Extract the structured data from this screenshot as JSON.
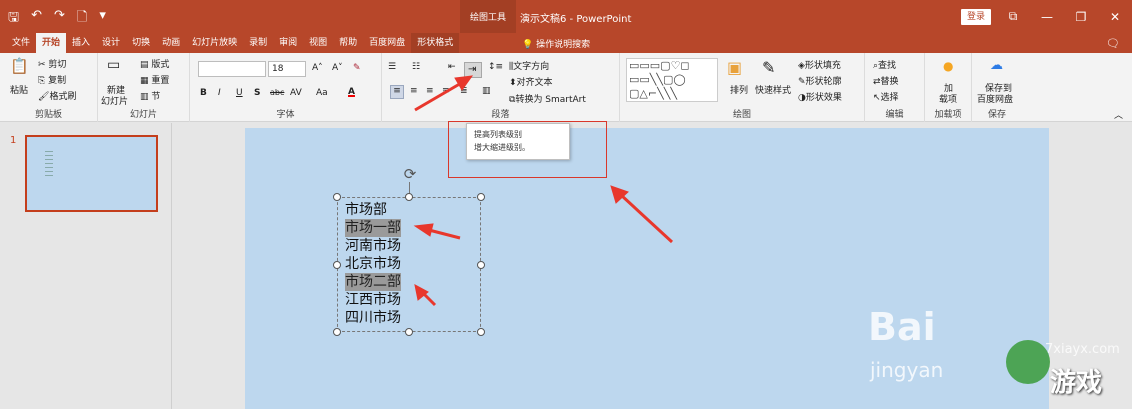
{
  "titlebar": {
    "context_tab_group": "绘图工具",
    "document_title": "演示文稿6 - PowerPoint",
    "login_label": "登录"
  },
  "tabs": [
    "文件",
    "开始",
    "插入",
    "设计",
    "切换",
    "动画",
    "幻灯片放映",
    "录制",
    "审阅",
    "视图",
    "帮助",
    "百度网盘",
    "形状格式"
  ],
  "active_tab": "开始",
  "tell_me": "操作说明搜索",
  "ribbon": {
    "clipboard": {
      "paste": "粘贴",
      "cut": "剪切",
      "copy": "复制",
      "format_painter": "格式刷",
      "label": "剪贴板"
    },
    "slides": {
      "new_slide_1": "新建",
      "new_slide_2": "幻灯片",
      "layout": "版式",
      "reset": "重置",
      "section": "节",
      "label": "幻灯片"
    },
    "font": {
      "size": "18",
      "bold": "B",
      "italic": "I",
      "underline": "U",
      "strike": "S",
      "abc": "abc",
      "spacing": "AV",
      "case": "Aa",
      "color": "A",
      "label": "字体"
    },
    "paragraph": {
      "text_direction": "文字方向",
      "align_text": "对齐文本",
      "smartart": "转换为 SmartArt",
      "label": "段落"
    },
    "drawing": {
      "arrange": "排列",
      "quick_styles": "快速样式",
      "fill": "形状填充",
      "outline": "形状轮廓",
      "effects": "形状效果",
      "label": "绘图"
    },
    "editing": {
      "find": "查找",
      "replace": "替换",
      "select": "选择",
      "label": "编辑"
    },
    "addins": {
      "add_1": "加",
      "add_2": "载项",
      "label": "加载项"
    },
    "save": {
      "save_1": "保存到",
      "save_2": "百度网盘",
      "label": "保存"
    }
  },
  "tooltip": {
    "title": "提高列表级别",
    "description": "增大缩进级别。"
  },
  "thumbnail_number": "1",
  "textbox_lines": [
    {
      "text": "市场部",
      "selected": false
    },
    {
      "text": "市场一部",
      "selected": true
    },
    {
      "text": "河南市场",
      "selected": false
    },
    {
      "text": "北京市场",
      "selected": false
    },
    {
      "text": "市场二部",
      "selected": true
    },
    {
      "text": "江西市场",
      "selected": false
    },
    {
      "text": "四川市场",
      "selected": false
    }
  ],
  "watermark": {
    "baidu": "Bai",
    "jingyan": "jingyan",
    "site": "7xiayx.com",
    "brand": "游戏"
  },
  "colors": {
    "accent": "#b7472a",
    "slide_bg": "#bdd7ee",
    "annotation_red": "#d9382b"
  }
}
